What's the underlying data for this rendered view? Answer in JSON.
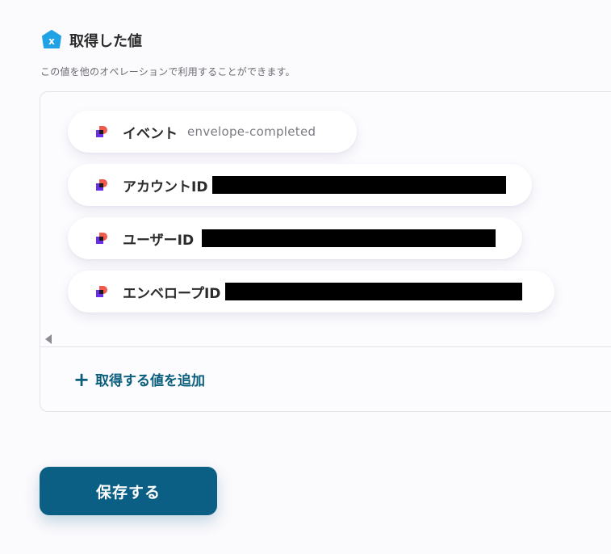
{
  "section": {
    "title": "取得した値",
    "description": "この値を他のオペレーションで利用することができます。",
    "icon": "x-hexagon-icon",
    "icon_color": "#1fa3e6"
  },
  "values": [
    {
      "label": "イベント",
      "value": "envelope-completed",
      "redacted": false
    },
    {
      "label": "アカウントID",
      "value": "",
      "redacted": true
    },
    {
      "label": "ユーザーID",
      "value": "",
      "redacted": true
    },
    {
      "label": "エンベロープID",
      "value": "",
      "redacted": true
    }
  ],
  "add_button": {
    "label": "取得する値を追加",
    "icon": "plus-icon"
  },
  "save_button": {
    "label": "保存する"
  },
  "colors": {
    "accent": "#0b5f84",
    "brand_icon_red": "#f05a4f",
    "brand_icon_purple": "#6a2ee8"
  }
}
